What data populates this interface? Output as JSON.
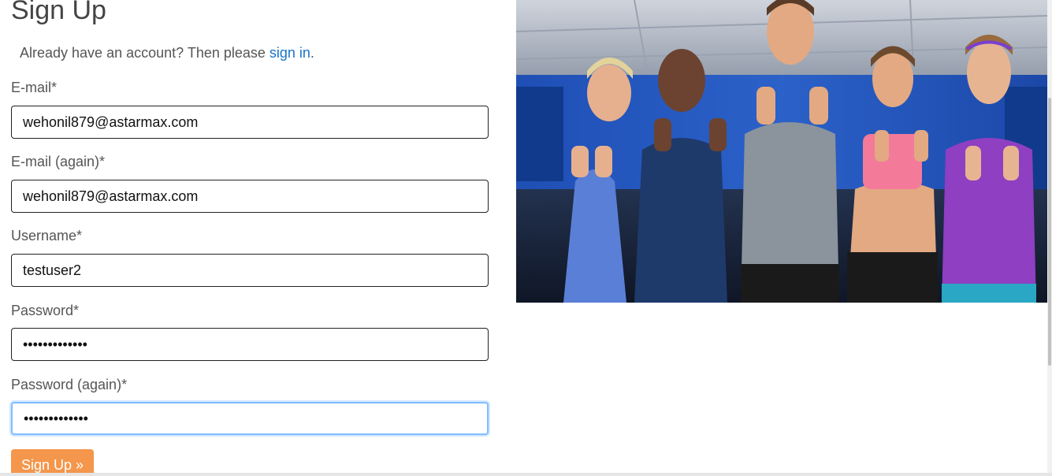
{
  "header": {
    "title": "Sign Up"
  },
  "signin": {
    "prefix": "Already have an account? Then please ",
    "link_label": "sign in",
    "suffix": "."
  },
  "form": {
    "email": {
      "label": "E-mail*",
      "value": "wehonil879@astarmax.com"
    },
    "email_again": {
      "label": "E-mail (again)*",
      "value": "wehonil879@astarmax.com"
    },
    "username": {
      "label": "Username*",
      "value": "testuser2"
    },
    "password": {
      "label": "Password*",
      "value": "•••••••••••••"
    },
    "password_again": {
      "label": "Password (again)*",
      "value": "•••••••••••••"
    },
    "submit_label": "Sign Up »"
  },
  "colors": {
    "link": "#1a73c8",
    "button": "#f4964b",
    "focus_ring": "#80bdff"
  }
}
